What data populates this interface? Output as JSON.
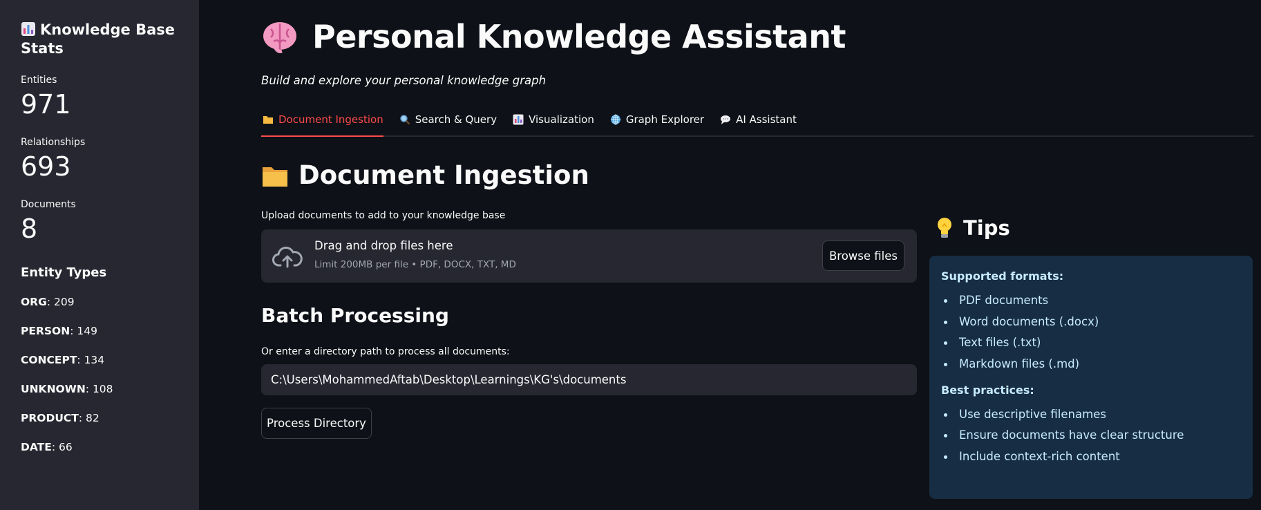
{
  "sidebar": {
    "title": "Knowledge Base Stats",
    "metrics": [
      {
        "label": "Entities",
        "value": "971"
      },
      {
        "label": "Relationships",
        "value": "693"
      },
      {
        "label": "Documents",
        "value": "8"
      }
    ],
    "entity_types_title": "Entity Types",
    "entity_types": [
      {
        "name": "ORG",
        "count": ": 209"
      },
      {
        "name": "PERSON",
        "count": ": 149"
      },
      {
        "name": "CONCEPT",
        "count": ": 134"
      },
      {
        "name": "UNKNOWN",
        "count": ": 108"
      },
      {
        "name": "PRODUCT",
        "count": ": 82"
      },
      {
        "name": "DATE",
        "count": ": 66"
      }
    ]
  },
  "header": {
    "title": "Personal Knowledge Assistant",
    "subtitle": "Build and explore your personal knowledge graph"
  },
  "tabs": [
    {
      "label": "Document Ingestion",
      "icon": "folder-icon",
      "active": true
    },
    {
      "label": "Search & Query",
      "icon": "magnifier-icon"
    },
    {
      "label": "Visualization",
      "icon": "chart-icon"
    },
    {
      "label": "Graph Explorer",
      "icon": "globe-icon"
    },
    {
      "label": "AI Assistant",
      "icon": "speech-bubble-icon"
    }
  ],
  "ingestion": {
    "heading": "Document Ingestion",
    "upload_label": "Upload documents to add to your knowledge base",
    "dropzone_main": "Drag and drop files here",
    "dropzone_sub": "Limit 200MB per file • PDF, DOCX, TXT, MD",
    "browse_label": "Browse files",
    "batch_heading": "Batch Processing",
    "dir_label": "Or enter a directory path to process all documents:",
    "dir_value": "C:\\Users\\MohammedAftab\\Desktop\\Learnings\\KG's\\documents",
    "process_label": "Process Directory"
  },
  "tips": {
    "title": "Tips",
    "formats_head": "Supported formats:",
    "formats": [
      "PDF documents",
      "Word documents (.docx)",
      "Text files (.txt)",
      "Markdown files (.md)"
    ],
    "practices_head": "Best practices:",
    "practices": [
      "Use descriptive filenames",
      "Ensure documents have clear structure",
      "Include context-rich content"
    ]
  },
  "colors": {
    "background": "#0e1117",
    "sidebar": "#262730",
    "accent": "#ff4b4b",
    "info_box": "#172d43",
    "info_text": "#c7ebff"
  }
}
